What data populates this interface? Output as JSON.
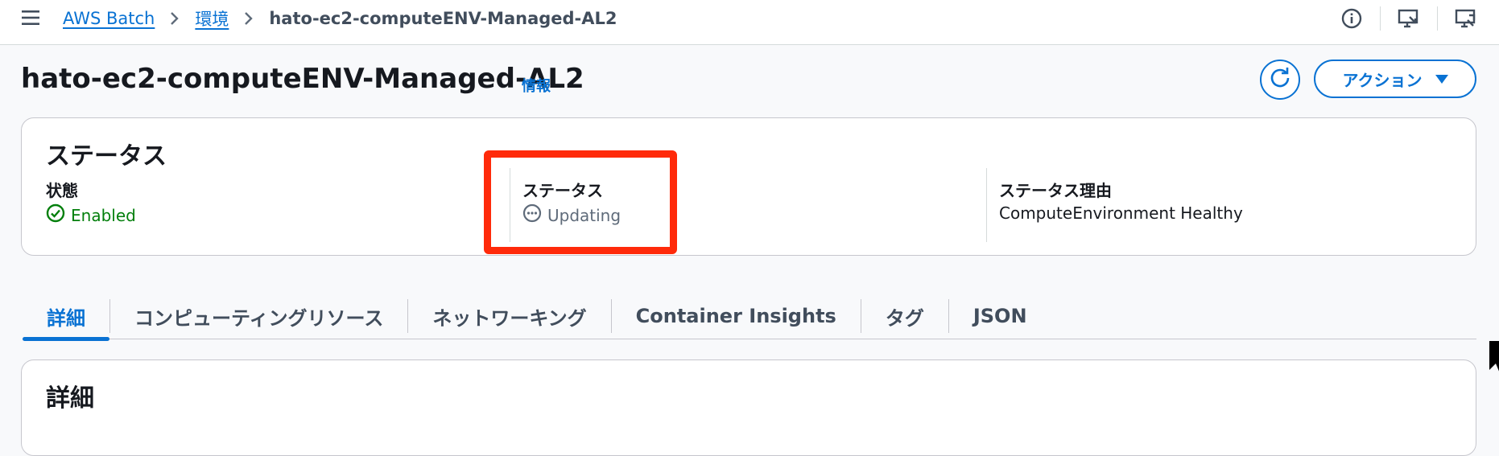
{
  "breadcrumb": {
    "service": "AWS Batch",
    "section": "環境",
    "current": "hato-ec2-computeENV-Managed-AL2"
  },
  "header": {
    "title": "hato-ec2-computeENV-Managed-AL2",
    "info_link": "情報",
    "action_label": "アクション"
  },
  "status_panel": {
    "title": "ステータス",
    "state_label": "状態",
    "state_value": "Enabled",
    "status_label": "ステータス",
    "status_value": "Updating",
    "reason_label": "ステータス理由",
    "reason_value": "ComputeEnvironment Healthy"
  },
  "tabs": [
    {
      "label": "詳細",
      "active": true
    },
    {
      "label": "コンピューティングリソース",
      "active": false
    },
    {
      "label": "ネットワーキング",
      "active": false
    },
    {
      "label": "Container Insights",
      "active": false
    },
    {
      "label": "タグ",
      "active": false
    },
    {
      "label": "JSON",
      "active": false
    }
  ],
  "details_panel": {
    "title": "詳細"
  },
  "colors": {
    "accent": "#0972d3",
    "success": "#037f0c",
    "neutral_status": "#5f6b7a",
    "highlight": "#ff2a0a"
  },
  "icons": [
    "menu-icon",
    "chevron-right-icon",
    "info-icon",
    "monitor-icon",
    "refresh-icon",
    "caret-down-icon",
    "check-circle-icon",
    "ellipsis-circle-icon"
  ]
}
